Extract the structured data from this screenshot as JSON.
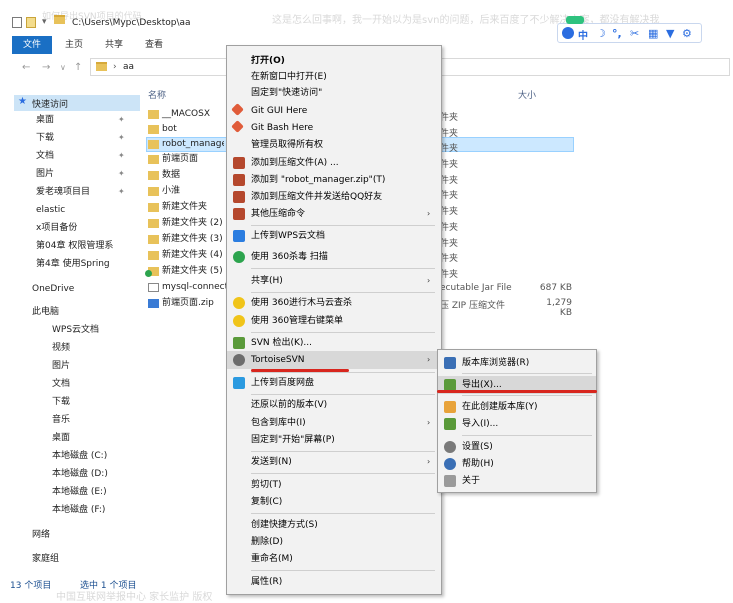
{
  "background": {
    "top_text": "这是怎么回事啊，我一开始以为是svn的问题，后来百度了不少解决方案，都没有解决我",
    "top_left_text": "如何导出SVN项目的代码",
    "bottom_text": "中国互联网举报中心 家长监护 版权"
  },
  "window": {
    "path_title": "C:\\Users\\Mypc\\Desktop\\aa",
    "address_folder": "aa"
  },
  "ribbon": {
    "tabs": [
      "文件",
      "主页",
      "共享",
      "查看"
    ]
  },
  "nav_pane": {
    "quick_access": "快速访问",
    "items": [
      "桌面",
      "下载",
      "文档",
      "图片",
      "爱老魂项目目",
      "elastic",
      "x项目备份",
      "第04章 权限管理系",
      "第4章 使用Spring"
    ],
    "onedrive": "OneDrive",
    "this_pc": "此电脑",
    "pc_items": [
      "WPS云文档",
      "视频",
      "图片",
      "文档",
      "下载",
      "音乐",
      "桌面",
      "本地磁盘 (C:)",
      "本地磁盘 (D:)",
      "本地磁盘 (E:)",
      "本地磁盘 (F:)"
    ],
    "network": "网络",
    "homegroup": "家庭组"
  },
  "file_list": {
    "headers": {
      "name": "名称",
      "type": "类型",
      "size": "大小"
    },
    "rows": [
      {
        "name": "__MACOSX",
        "type": "件夹",
        "size": ""
      },
      {
        "name": "bot",
        "type": "件夹",
        "size": ""
      },
      {
        "name": "robot_manager",
        "type": "件夹",
        "size": ""
      },
      {
        "name": "前端页面",
        "type": "件夹",
        "size": ""
      },
      {
        "name": "数据",
        "type": "件夹",
        "size": ""
      },
      {
        "name": "小淮",
        "type": "件夹",
        "size": ""
      },
      {
        "name": "新建文件夹",
        "type": "件夹",
        "size": ""
      },
      {
        "name": "新建文件夹 (2)",
        "type": "件夹",
        "size": ""
      },
      {
        "name": "新建文件夹 (3)",
        "type": "件夹",
        "size": ""
      },
      {
        "name": "新建文件夹 (4)",
        "type": "件夹",
        "size": ""
      },
      {
        "name": "新建文件夹 (5)",
        "type": "件夹",
        "size": ""
      },
      {
        "name": "mysql-connect",
        "type": "ecutable Jar File",
        "size": "687 KB"
      },
      {
        "name": "前端页面.zip",
        "type": "压 ZIP 压缩文件",
        "size": "1,279 KB"
      }
    ]
  },
  "status_bar": {
    "count": "13 个项目",
    "selected": "选中 1 个项目"
  },
  "context_menu": {
    "items": [
      "打开(O)",
      "在新窗口中打开(E)",
      "固定到\"快速访问\"",
      "Git GUI Here",
      "Git Bash Here",
      "管理员取得所有权",
      "添加到压缩文件(A) ...",
      "添加到 \"robot_manager.zip\"(T)",
      "添加到压缩文件并发送给QQ好友",
      "其他压缩命令",
      "上传到WPS云文档",
      "使用 360杀毒 扫描",
      "共享(H)",
      "使用 360进行木马云查杀",
      "使用 360管理右键菜单",
      "SVN 检出(K)...",
      "TortoiseSVN",
      "上传到百度网盘",
      "还原以前的版本(V)",
      "包含到库中(I)",
      "固定到\"开始\"屏幕(P)",
      "发送到(N)",
      "剪切(T)",
      "复制(C)",
      "创建快捷方式(S)",
      "删除(D)",
      "重命名(M)",
      "属性(R)"
    ]
  },
  "svn_submenu": {
    "items": [
      "版本库浏览器(R)",
      "导出(X)...",
      "在此创建版本库(Y)",
      "导入(I)...",
      "设置(S)",
      "帮助(H)",
      "关于"
    ]
  },
  "floating_toolbar": {
    "ime_label": "中"
  },
  "colors": {
    "accent": "#1a6fc4",
    "highlight": "#cce8ff",
    "annotation": "#d8261e"
  }
}
